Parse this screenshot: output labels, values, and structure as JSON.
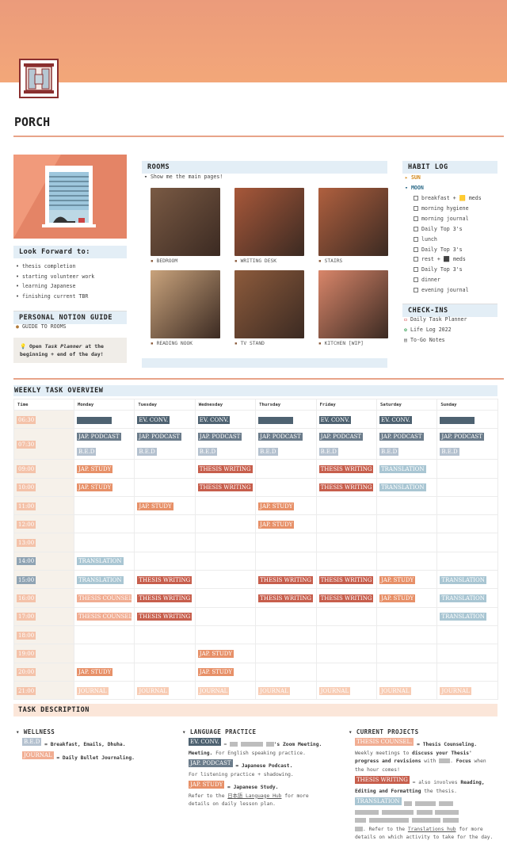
{
  "page": {
    "title": "PORCH"
  },
  "sidebar": {
    "look_forward_title": "Look Forward to:",
    "look_forward_items": [
      "thesis completion",
      "starting volunteer work",
      "learning Japanese",
      "finishing current TBR"
    ],
    "guide_title": "PERSONAL NOTION GUIDE",
    "guide_link": "GUIDE TO ROOMS",
    "callout_prefix": "Open ",
    "callout_italic": "Task Planner",
    "callout_suffix": " at the beginning + end of the day!"
  },
  "rooms": {
    "title": "ROOMS",
    "toggle": "Show me the main pages!",
    "items": [
      {
        "label": "BEDROOM",
        "color": "#7a5a44"
      },
      {
        "label": "WRITING DESK",
        "color": "#a8583a"
      },
      {
        "label": "STAIRS",
        "color": "#b0603f"
      },
      {
        "label": "READING NOOK",
        "color": "#c9a37c"
      },
      {
        "label": "TV STAND",
        "color": "#8d5b3c"
      },
      {
        "label": "KITCHEN [WIP]",
        "color": "#d9866a"
      }
    ]
  },
  "habit_log": {
    "title": "HABIT LOG",
    "sun": "SUN",
    "moon": "MOON",
    "items": [
      "breakfast + 🟨 meds",
      "morning hygiene",
      "morning journal",
      "Daily Top 3's",
      "lunch",
      "Daily Top 3's",
      "rest + ⬛ meds",
      "Daily Top 3's",
      "dinner",
      "evening journal"
    ]
  },
  "checkins": {
    "title": "CHECK-INS",
    "items": [
      "Daily Task Planner",
      "Life Log 2022",
      "To-Go Notes"
    ]
  },
  "weekly": {
    "title": "WEEKLY TASK OVERVIEW",
    "headers": [
      "Time",
      "Monday",
      "Tuesday",
      "Wednesday",
      "Thursday",
      "Friday",
      "Saturday",
      "Sunday"
    ],
    "rows": [
      {
        "time": "06:30",
        "cells": [
          [
            {
              "c": "blk"
            }
          ],
          [
            {
              "c": "ev",
              "t": "EV. CONV."
            }
          ],
          [
            {
              "c": "ev",
              "t": "EV. CONV."
            }
          ],
          [
            {
              "c": "blk"
            }
          ],
          [
            {
              "c": "ev",
              "t": "EV. CONV."
            }
          ],
          [
            {
              "c": "ev",
              "t": "EV. CONV."
            }
          ],
          [
            {
              "c": "blk"
            }
          ]
        ]
      },
      {
        "time": "07:30",
        "cells": [
          [
            {
              "c": "pod",
              "t": "JAP. PODCAST"
            },
            {
              "c": "bed",
              "t": "B.E.D"
            }
          ],
          [
            {
              "c": "pod",
              "t": "JAP. PODCAST"
            },
            {
              "c": "bed",
              "t": "B.E.D"
            }
          ],
          [
            {
              "c": "pod",
              "t": "JAP. PODCAST"
            },
            {
              "c": "bed",
              "t": "B.E.D"
            }
          ],
          [
            {
              "c": "pod",
              "t": "JAP. PODCAST"
            },
            {
              "c": "bed",
              "t": "B.E.D"
            }
          ],
          [
            {
              "c": "pod",
              "t": "JAP. PODCAST"
            },
            {
              "c": "bed",
              "t": "B.E.D"
            }
          ],
          [
            {
              "c": "pod",
              "t": "JAP. PODCAST"
            },
            {
              "c": "bed",
              "t": "B.E.D"
            }
          ],
          [
            {
              "c": "pod",
              "t": "JAP. PODCAST"
            },
            {
              "c": "bed",
              "t": "B.E.D"
            }
          ]
        ]
      },
      {
        "time": "09:00",
        "cells": [
          [
            {
              "c": "js",
              "t": "JAP. STUDY"
            }
          ],
          [],
          [
            {
              "c": "tw",
              "t": "THESIS WRITING"
            }
          ],
          [],
          [
            {
              "c": "tw",
              "t": "THESIS WRITING"
            }
          ],
          [
            {
              "c": "tr",
              "t": "TRANSLATION"
            }
          ],
          []
        ]
      },
      {
        "time": "10:00",
        "cells": [
          [
            {
              "c": "js",
              "t": "JAP. STUDY"
            }
          ],
          [],
          [
            {
              "c": "tw",
              "t": "THESIS WRITING"
            }
          ],
          [],
          [
            {
              "c": "tw",
              "t": "THESIS WRITING"
            }
          ],
          [
            {
              "c": "tr",
              "t": "TRANSLATION"
            }
          ],
          []
        ]
      },
      {
        "time": "11:00",
        "cells": [
          [],
          [
            {
              "c": "js",
              "t": "JAP. STUDY"
            }
          ],
          [],
          [
            {
              "c": "js",
              "t": "JAP. STUDY"
            }
          ],
          [],
          [],
          []
        ]
      },
      {
        "time": "12:00",
        "cells": [
          [],
          [],
          [],
          [
            {
              "c": "js",
              "t": "JAP. STUDY"
            }
          ],
          [],
          [],
          []
        ]
      },
      {
        "time": "13:00",
        "cells": [
          [],
          [],
          [],
          [],
          [],
          [],
          []
        ]
      },
      {
        "time": "14:00",
        "cells": [
          [
            {
              "c": "tr",
              "t": "TRANSLATION"
            }
          ],
          [],
          [],
          [],
          [],
          [],
          []
        ]
      },
      {
        "time": "15:00",
        "cells": [
          [
            {
              "c": "tr",
              "t": "TRANSLATION"
            }
          ],
          [
            {
              "c": "tw",
              "t": "THESIS WRITING"
            }
          ],
          [],
          [
            {
              "c": "tw",
              "t": "THESIS WRITING"
            }
          ],
          [
            {
              "c": "tw",
              "t": "THESIS WRITING"
            }
          ],
          [
            {
              "c": "js",
              "t": "JAP. STUDY"
            }
          ],
          [
            {
              "c": "tr",
              "t": "TRANSLATION"
            }
          ]
        ]
      },
      {
        "time": "16:00",
        "cells": [
          [
            {
              "c": "tc",
              "t": "THESIS COUNSEL."
            }
          ],
          [
            {
              "c": "tw",
              "t": "THESIS WRITING"
            }
          ],
          [],
          [
            {
              "c": "tw",
              "t": "THESIS WRITING"
            }
          ],
          [
            {
              "c": "tw",
              "t": "THESIS WRITING"
            }
          ],
          [
            {
              "c": "js",
              "t": "JAP. STUDY"
            }
          ],
          [
            {
              "c": "tr",
              "t": "TRANSLATION"
            }
          ]
        ]
      },
      {
        "time": "17:00",
        "cells": [
          [
            {
              "c": "tc",
              "t": "THESIS COUNSEL."
            }
          ],
          [
            {
              "c": "tw",
              "t": "THESIS WRITING"
            }
          ],
          [],
          [],
          [],
          [],
          [
            {
              "c": "tr",
              "t": "TRANSLATION"
            }
          ]
        ]
      },
      {
        "time": "18:00",
        "cells": [
          [],
          [],
          [],
          [],
          [],
          [],
          []
        ]
      },
      {
        "time": "19:00",
        "cells": [
          [],
          [],
          [
            {
              "c": "js",
              "t": "JAP. STUDY"
            }
          ],
          [],
          [],
          [],
          []
        ]
      },
      {
        "time": "20:00",
        "cells": [
          [
            {
              "c": "js",
              "t": "JAP. STUDY"
            }
          ],
          [],
          [
            {
              "c": "js",
              "t": "JAP. STUDY"
            }
          ],
          [],
          [],
          [],
          []
        ]
      },
      {
        "time": "21:00",
        "cells": [
          [
            {
              "c": "jr",
              "t": "JOURNAL"
            }
          ],
          [
            {
              "c": "jr",
              "t": "JOURNAL"
            }
          ],
          [
            {
              "c": "jr",
              "t": "JOURNAL"
            }
          ],
          [
            {
              "c": "jr",
              "t": "JOURNAL"
            }
          ],
          [
            {
              "c": "jr",
              "t": "JOURNAL"
            }
          ],
          [
            {
              "c": "jr",
              "t": "JOURNAL"
            }
          ],
          [
            {
              "c": "jr",
              "t": "JOURNAL"
            }
          ]
        ]
      }
    ]
  },
  "task_desc": {
    "title": "TASK DESCRIPTION",
    "wellness": {
      "title": "WELLNESS",
      "bed_tag": "B.E.D",
      "bed_text": "= Breakfast, Emails, Dhuha.",
      "journal_tag": "JOURNAL",
      "journal_text": "= Daily Bullet Journaling."
    },
    "language": {
      "title": "LANGUAGE PRACTICE",
      "ev_tag": "EV. CONV.",
      "ev_eq": " = ",
      "ev_bold2": "'s Zoom Meeting.",
      "ev_text": " For English speaking practice.",
      "pod_tag": "JAP. PODCAST",
      "pod_bold": " = Japanese Podcast.",
      "pod_text": "For listening practice + shadowing.",
      "js_tag": "JAP. STUDY",
      "js_bold": " = Japanese Study.",
      "js_text1": "Refer to the ",
      "js_link": "日本語 Language Hub",
      "js_text2": " for more details on daily lesson plan."
    },
    "projects": {
      "title": "CURRENT PROJECTS",
      "tc_tag": "THESIS COUNSEL.",
      "tc_bold": " = Thesis Counseling.",
      "tc_text1": "Weekly meetings to ",
      "tc_b2": "discuss your Thesis' progress and revisions",
      "tc_text2": " with ",
      "tc_text3": ". ",
      "tc_b3": "Focus",
      "tc_text4": " when the hour comes!",
      "tw_tag": "THESIS WRITING",
      "tw_text": " = also involves ",
      "tw_bold": "Reading, Editing and Formatting",
      "tw_text2": " the thesis.",
      "tr_tag": "TRANSLATION",
      "tr_text1": ". Refer to the ",
      "tr_link": "Translations hub",
      "tr_text2": " for more details on which activity to take for the day."
    }
  }
}
